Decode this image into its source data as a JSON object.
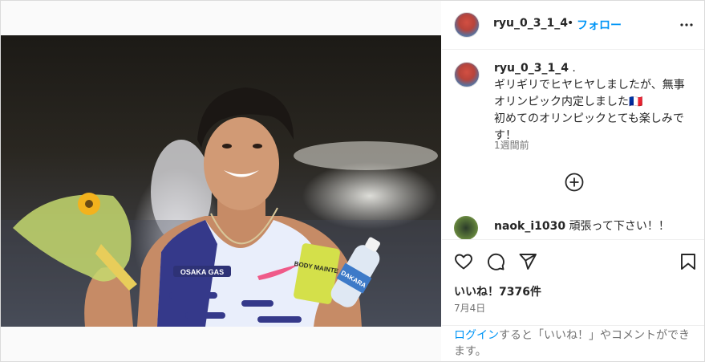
{
  "post": {
    "username": "ryu_0_3_1_4",
    "follow_label": "フォロー",
    "dot": "•",
    "caption_lines": [
      "ギリギリでヒヤヒヤしましたが、無事",
      "オリンピック内定しました🇫🇷",
      "初めてのオリンピックとても楽しみで",
      "す！"
    ],
    "caption_username_suffix": ".",
    "time_ago": "1週間前",
    "comment": {
      "username": "naok_i1030",
      "text": "頑張って下さい！！"
    },
    "likes": "いいね！7376件",
    "date": "7月4日",
    "login": {
      "link": "ログイン",
      "rest": "すると「いいね！」やコメントができます。"
    }
  },
  "photo": {
    "chest_brand": "OSAKA GAS",
    "pack_text": "BODY MAINTE",
    "bottle_text": "DAKARA"
  },
  "colors": {
    "accent": "#0095f6",
    "text": "#262626",
    "muted": "#737373"
  },
  "icons": [
    "more-icon",
    "add-comment-icon",
    "heart-icon",
    "comment-icon",
    "share-icon",
    "save-icon"
  ]
}
